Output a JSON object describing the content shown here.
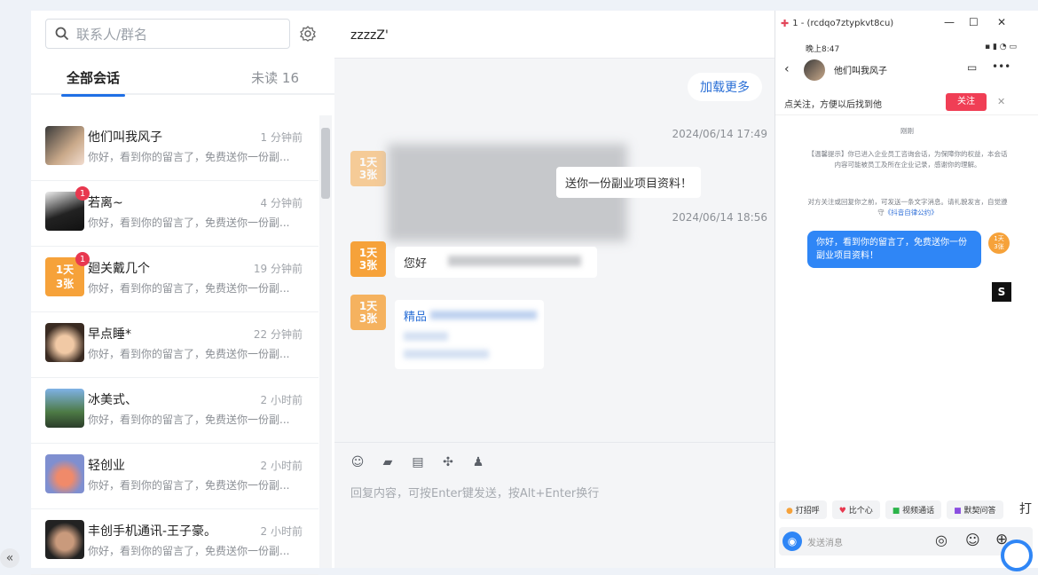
{
  "sidebar": {
    "search_placeholder": "联系人/群名",
    "tab_all": "全部会话",
    "tab_unread": "未读 16",
    "conversations": [
      {
        "name": "他们叫我风子",
        "time": "1 分钟前",
        "preview": "你好，看到你的留言了，免费送你一份副...",
        "badge": ""
      },
      {
        "name": "若离~",
        "time": "4 分钟前",
        "preview": "你好，看到你的留言了，免费送你一份副...",
        "badge": "1"
      },
      {
        "name": "廻关戴几个",
        "time": "19 分钟前",
        "preview": "你好，看到你的留言了，免费送你一份副...",
        "badge": "1"
      },
      {
        "name": "早点睡*",
        "time": "22 分钟前",
        "preview": "你好，看到你的留言了，免费送你一份副...",
        "badge": ""
      },
      {
        "name": "冰美式、",
        "time": "2 小时前",
        "preview": "你好，看到你的留言了，免费送你一份副...",
        "badge": ""
      },
      {
        "name": "轻创业",
        "time": "2 小时前",
        "preview": "你好，看到你的留言了，免费送你一份副...",
        "badge": ""
      },
      {
        "name": "丰创手机通讯-王子豪。",
        "time": "2 小时前",
        "preview": "你好，看到你的留言了，免费送你一份副...",
        "badge": ""
      }
    ]
  },
  "chat": {
    "title": "zzzzZ'",
    "load_more": "加载更多",
    "timestamp1": "2024/06/14 17:49",
    "timestamp2": "2024/06/14 18:56",
    "msg1_visible": "送你一份副业项目资料！",
    "msg2_visible_start": "您好",
    "msg3_visible": "精品",
    "avatar_text": "1天\n3张",
    "composer_placeholder": "回复内容，可按Enter键发送，按Alt+Enter换行"
  },
  "phone": {
    "window_title": "1 - (rcdqo7ztypkvt8cu)",
    "status_time": "晚上8:47",
    "contact_name": "他们叫我风子",
    "follow_prompt": "点关注，方便以后找到他",
    "follow_button": "关注",
    "just_now": "刚刚",
    "notice": "【温馨提示】你已进入企业员工咨询会话，为保障你的权益，本会话内容可能被员工及所在企业记录，感谢你的理解。",
    "notice2": "对方关注或回复你之前，可发送一条文字消息。请礼貌发言，自觉遵守",
    "notice2_link": "《抖音自律公约》",
    "sent_message": "你好，看到你的留言了，免费送你一份副业项目资料！",
    "actions": [
      "打招呼",
      "比个心",
      "视频通话",
      "默契问答"
    ],
    "input_placeholder": "发送消息",
    "side_partial": "打"
  },
  "colors": {
    "accent": "#1f6fe5",
    "badge": "#e8384f",
    "follow": "#f03e55",
    "bubble": "#2f86f6"
  }
}
